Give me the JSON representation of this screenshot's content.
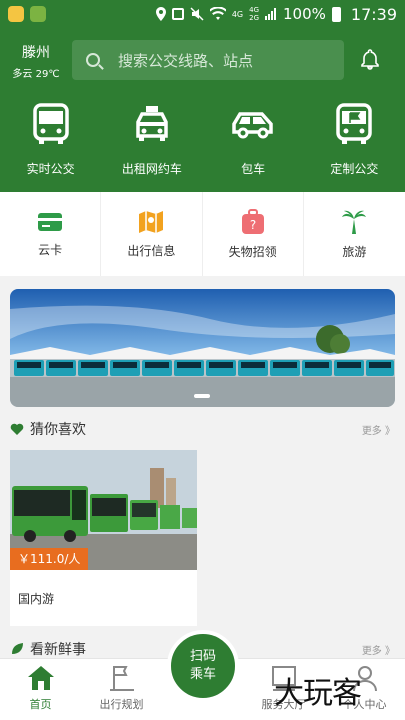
{
  "status_bar": {
    "network_4g_1": "4G",
    "network_4g_2": "4G",
    "network_2g": "2G",
    "battery": "100%",
    "time": "17:39"
  },
  "header": {
    "city": "滕州",
    "weather": "多云 29℃",
    "search_placeholder": "搜索公交线路、站点"
  },
  "top_nav": [
    {
      "label": "实时公交",
      "icon": "bus-icon"
    },
    {
      "label": "出租网约车",
      "icon": "taxi-icon"
    },
    {
      "label": "包车",
      "icon": "car-icon"
    },
    {
      "label": "定制公交",
      "icon": "custom-bus-icon"
    }
  ],
  "services": [
    {
      "label": "云卡",
      "icon": "card-icon",
      "color": "#2e9b48"
    },
    {
      "label": "出行信息",
      "icon": "map-icon",
      "color": "#f2a21f"
    },
    {
      "label": "失物招领",
      "icon": "luggage-icon",
      "color": "#ee6e73"
    },
    {
      "label": "旅游",
      "icon": "palm-tree-icon",
      "color": "#2e9b48"
    }
  ],
  "sections": {
    "guess": {
      "title": "猜你喜欢",
      "more": "更多 》"
    },
    "news": {
      "title": "看新鲜事",
      "more": "更多 》"
    }
  },
  "product": {
    "price": "￥111.0/人",
    "title": "国内游"
  },
  "bottom_nav": {
    "home": "首页",
    "plan": "出行规划",
    "scan_line1": "扫码",
    "scan_line2": "乘车",
    "service": "服务大厅",
    "mine": "个人中心"
  },
  "watermark": "大玩客",
  "colors": {
    "primary": "#2e7d32",
    "price": "#e86d1f"
  }
}
